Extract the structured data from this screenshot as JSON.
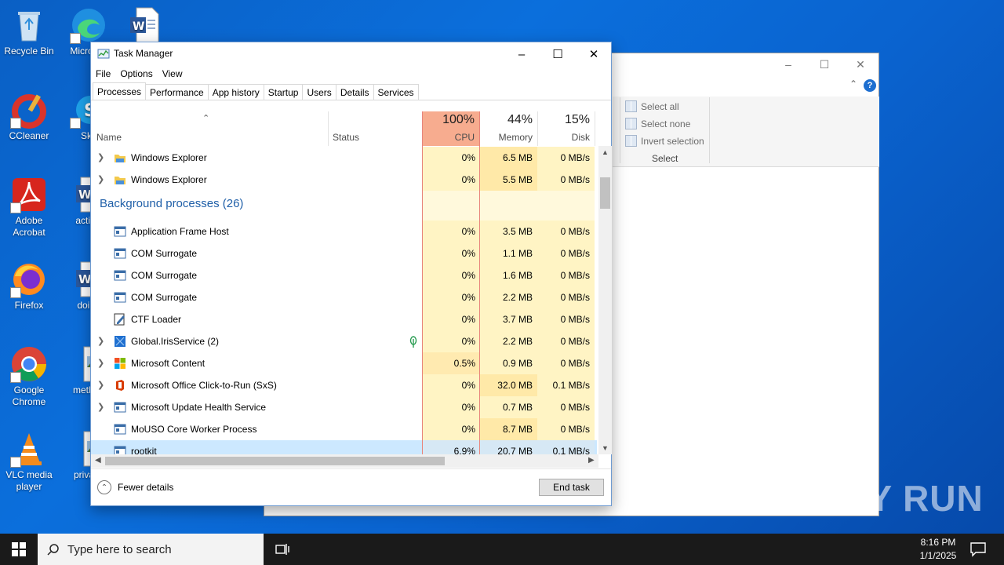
{
  "desktop": {
    "icons": [
      {
        "label": "Recycle Bin"
      },
      {
        "label": "Micro Ed"
      },
      {
        "label": ""
      },
      {
        "label": "CCleaner"
      },
      {
        "label": "Sky"
      },
      {
        "label": "Adobe Acrobat"
      },
      {
        "label": "activiti"
      },
      {
        "label": "Firefox"
      },
      {
        "label": "doing"
      },
      {
        "label": "Google Chrome"
      },
      {
        "label": "method"
      },
      {
        "label": "VLC media player"
      },
      {
        "label": "privacy"
      }
    ]
  },
  "explorer": {
    "select_all": "Select all",
    "select_none": "Select none",
    "invert_selection": "Invert selection",
    "group_label": "Select"
  },
  "taskmanager": {
    "title": "Task Manager",
    "menu": [
      "File",
      "Options",
      "View"
    ],
    "tabs": [
      "Processes",
      "Performance",
      "App history",
      "Startup",
      "Users",
      "Details",
      "Services"
    ],
    "columns": {
      "name": "Name",
      "status": "Status",
      "cpu_pct": "100%",
      "cpu": "CPU",
      "mem_pct": "44%",
      "mem": "Memory",
      "disk_pct": "15%",
      "disk": "Disk"
    },
    "group_title": "Background processes (26)",
    "rows": [
      {
        "name": "Windows Explorer",
        "cpu": "0%",
        "mem": "6.5 MB",
        "disk": "0 MB/s",
        "expandable": true
      },
      {
        "name": "Windows Explorer",
        "cpu": "0%",
        "mem": "5.5 MB",
        "disk": "0 MB/s",
        "expandable": true
      },
      {
        "name": "Application Frame Host",
        "cpu": "0%",
        "mem": "3.5 MB",
        "disk": "0 MB/s",
        "expandable": false
      },
      {
        "name": "COM Surrogate",
        "cpu": "0%",
        "mem": "1.1 MB",
        "disk": "0 MB/s",
        "expandable": false
      },
      {
        "name": "COM Surrogate",
        "cpu": "0%",
        "mem": "1.6 MB",
        "disk": "0 MB/s",
        "expandable": false
      },
      {
        "name": "COM Surrogate",
        "cpu": "0%",
        "mem": "2.2 MB",
        "disk": "0 MB/s",
        "expandable": false
      },
      {
        "name": "CTF Loader",
        "cpu": "0%",
        "mem": "3.7 MB",
        "disk": "0 MB/s",
        "expandable": false
      },
      {
        "name": "Global.IrisService (2)",
        "cpu": "0%",
        "mem": "2.2 MB",
        "disk": "0 MB/s",
        "expandable": true
      },
      {
        "name": "Microsoft Content",
        "cpu": "0.5%",
        "mem": "0.9 MB",
        "disk": "0 MB/s",
        "expandable": true
      },
      {
        "name": "Microsoft Office Click-to-Run (SxS)",
        "cpu": "0%",
        "mem": "32.0 MB",
        "disk": "0.1 MB/s",
        "expandable": true
      },
      {
        "name": "Microsoft Update Health Service",
        "cpu": "0%",
        "mem": "0.7 MB",
        "disk": "0 MB/s",
        "expandable": true
      },
      {
        "name": "MoUSO Core Worker Process",
        "cpu": "0%",
        "mem": "8.7 MB",
        "disk": "0 MB/s",
        "expandable": false
      },
      {
        "name": "rootkit",
        "cpu": "6.9%",
        "mem": "20.7 MB",
        "disk": "0.1 MB/s",
        "expandable": false
      }
    ],
    "fewer_details": "Fewer details",
    "end_task": "End task"
  },
  "taskbar": {
    "search_placeholder": "Type here to search",
    "time": "8:16 PM",
    "date": "1/1/2025"
  },
  "watermark": "ANY RUN"
}
